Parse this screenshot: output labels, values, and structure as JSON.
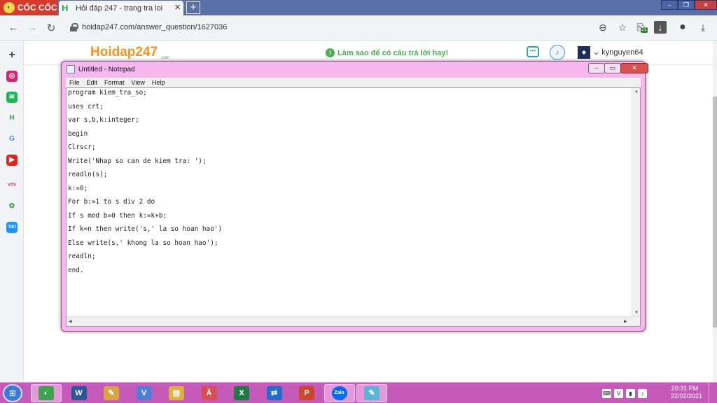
{
  "browser": {
    "brand": "CỐC CỐC",
    "tab": {
      "title": "Hỏi đáp 247 - trang tra loi",
      "favicon": "H"
    },
    "new_tab_symbol": "+",
    "window_controls": [
      "–",
      "❐",
      "✕"
    ],
    "url": "hoidap247.com/answer_question/1627036",
    "download_badge": "21"
  },
  "page": {
    "logo": "Hoidap247",
    "logo_sub": ".com",
    "tip": "Làm sao để có câu trả lời hay!",
    "username": "kynguyen64"
  },
  "sidebar": {
    "icons": [
      {
        "name": "add-icon",
        "glyph": "+",
        "color": "#f3f4f7",
        "text_color": "#444"
      },
      {
        "name": "instagram-icon",
        "glyph": "◎",
        "color": "#d6246e",
        "text_color": "#fff"
      },
      {
        "name": "spotify-icon",
        "glyph": "≋",
        "color": "#1db954",
        "text_color": "#fff"
      },
      {
        "name": "hoidap-icon",
        "glyph": "H",
        "color": "#f3f4f7",
        "text_color": "#2da44e"
      },
      {
        "name": "google-icon",
        "glyph": "G",
        "color": "#f3f4f7",
        "text_color": "#4285f4"
      },
      {
        "name": "youtube-icon",
        "glyph": "▶",
        "color": "#e62117",
        "text_color": "#fff"
      },
      {
        "name": "vtv-icon",
        "glyph": "VTV",
        "color": "#f3f4f7",
        "text_color": "#c0272d"
      },
      {
        "name": "game-icon",
        "glyph": "✿",
        "color": "#f3f4f7",
        "text_color": "#3fa34d"
      },
      {
        "name": "tiki-icon",
        "glyph": "TIKI",
        "color": "#1a94ff",
        "text_color": "#fff"
      }
    ]
  },
  "notepad": {
    "title": "Untitled - Notepad",
    "menu": [
      "File",
      "Edit",
      "Format",
      "View",
      "Help"
    ],
    "controls": [
      "–",
      "▭",
      "✕"
    ],
    "lines": [
      "program kiem_tra_so;",
      "uses crt;",
      "var s,b,k:integer;",
      "begin",
      "Clrscr;",
      "Write('Nhap so can de kiem tra: ');",
      "readln(s);",
      "k:=0;",
      "For b:=1 to s div 2 do",
      "If s mod b=0 then k:=k+b;",
      "If k=n then write('s,' la so hoan hao')",
      "Else write(s,' khong la so hoan hao');",
      "readln;",
      "end."
    ]
  },
  "taskbar": {
    "apps": [
      {
        "name": "coccoc-taskbar-button",
        "glyph": "◐",
        "color": "#3fa34d",
        "active": true
      },
      {
        "name": "word-taskbar-button",
        "glyph": "W",
        "color": "#2b579a",
        "active": false
      },
      {
        "name": "paint-taskbar-button",
        "glyph": "✎",
        "color": "#d9a441",
        "active": false
      },
      {
        "name": "unikey-taskbar-button",
        "glyph": "V",
        "color": "#4f7fd4",
        "active": false
      },
      {
        "name": "explorer-taskbar-button",
        "glyph": "▤",
        "color": "#e0b23d",
        "active": false
      },
      {
        "name": "vietkey-taskbar-button",
        "glyph": "Ä",
        "color": "#d94f4f",
        "active": false
      },
      {
        "name": "excel-taskbar-button",
        "glyph": "X",
        "color": "#1f7a43",
        "active": false
      },
      {
        "name": "teamviewer-taskbar-button",
        "glyph": "⇄",
        "color": "#1f6fd1",
        "active": false
      },
      {
        "name": "powerpoint-taskbar-button",
        "glyph": "P",
        "color": "#d0462a",
        "active": false
      },
      {
        "name": "zalo-taskbar-button",
        "glyph": "Zalo",
        "color": "#0068ff",
        "active": true
      },
      {
        "name": "notepad-taskbar-button",
        "glyph": "✎",
        "color": "#5ab4d6",
        "active": true
      }
    ],
    "tray": [
      {
        "name": "tray-language-icon",
        "glyph": "⌨"
      },
      {
        "name": "tray-vietkey-icon",
        "glyph": "V"
      },
      {
        "name": "tray-network-icon",
        "glyph": "▮"
      },
      {
        "name": "tray-volume-icon",
        "glyph": "♪"
      }
    ],
    "time": "20:31 PM",
    "date": "22/02/2021"
  }
}
